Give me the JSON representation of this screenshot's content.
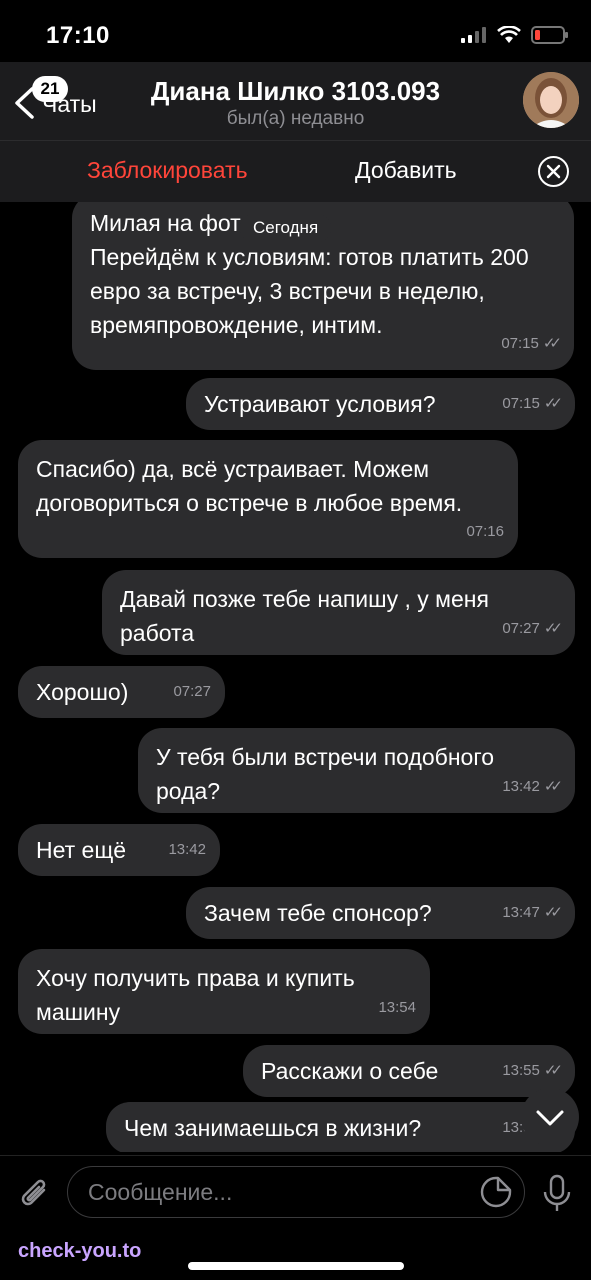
{
  "status": {
    "time": "17:10"
  },
  "header": {
    "back_label": "Чаты",
    "badge": "21",
    "title": "Диана Шилко 3103.093",
    "subtitle": "был(а) недавно"
  },
  "actions": {
    "block": "Заблокировать",
    "add": "Добавить"
  },
  "date_pill": "Сегодня",
  "messages": [
    {
      "dir": "in",
      "text": "Милая на фото)\nПерейдём к условиям: готов платить 200 евро за встречу, 3 встречи в неделю, времяпровождение, интим.",
      "time": "07:15",
      "read": true
    },
    {
      "dir": "out",
      "text": "Устраивают условия?",
      "time": "07:15",
      "read": true
    },
    {
      "dir": "in",
      "text": "Спасибо) да, всё устраивает. Можем договориться о встрече в любое время.",
      "time": "07:16",
      "read": false
    },
    {
      "dir": "out",
      "text": "Давай позже тебе напишу , у меня работа",
      "time": "07:27",
      "read": true
    },
    {
      "dir": "in",
      "text": "Хорошо)",
      "time": "07:27",
      "read": false
    },
    {
      "dir": "out",
      "text": "У тебя были встречи подобного рода?",
      "time": "13:42",
      "read": true
    },
    {
      "dir": "in",
      "text": "Нет ещё",
      "time": "13:42",
      "read": false
    },
    {
      "dir": "out",
      "text": "Зачем тебе спонсор?",
      "time": "13:47",
      "read": true
    },
    {
      "dir": "in",
      "text": "Хочу получить права и купить машину",
      "time": "13:54",
      "read": false
    },
    {
      "dir": "out",
      "text": "Расскажи о себе",
      "time": "13:55",
      "read": true
    },
    {
      "dir": "out",
      "text": "Чем занимаешься в жизни?",
      "time": "13:55",
      "read": true
    }
  ],
  "input": {
    "placeholder": "Сообщение..."
  },
  "watermark": "check-you.to",
  "colors": {
    "background": "#000000",
    "bubble": "#2c2c2e",
    "danger": "#ff453a",
    "muted": "#8e8e93"
  }
}
